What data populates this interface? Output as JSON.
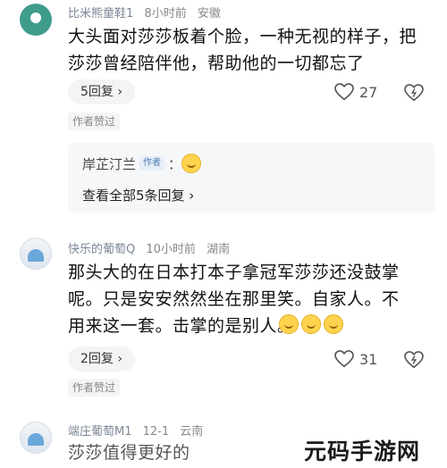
{
  "comments": [
    {
      "nick": "比米熊童鞋1",
      "time": "8小时前",
      "location": "安徽",
      "text": "大头面对莎莎板着个脸，一种无视的样子，把莎莎曾经陪伴他，帮助他的一切都忘了",
      "replies_label": "5回复 ›",
      "likes": "27",
      "author_liked": "作者赞过",
      "reply_preview": {
        "name": "岸芷汀兰",
        "author_tag": "作者",
        "colon": "：",
        "emoji_icon": "clapping-emoji-icon",
        "view_all": "查看全部5条回复 ›"
      }
    },
    {
      "nick": "快乐的葡萄Q",
      "time": "10小时前",
      "location": "湖南",
      "text": "那头大的在日本打本子拿冠军莎莎还没鼓掌呢。只是安安然然坐在那里笑。自家人。不用来这一套。击掌的是别人。",
      "replies_label": "2回复 ›",
      "likes": "31",
      "author_liked": "作者赞过"
    },
    {
      "nick": "端庄葡萄M1",
      "time": "12-1",
      "location": "云南",
      "text": "莎莎值得更好的"
    }
  ],
  "watermark": "元码手游网"
}
